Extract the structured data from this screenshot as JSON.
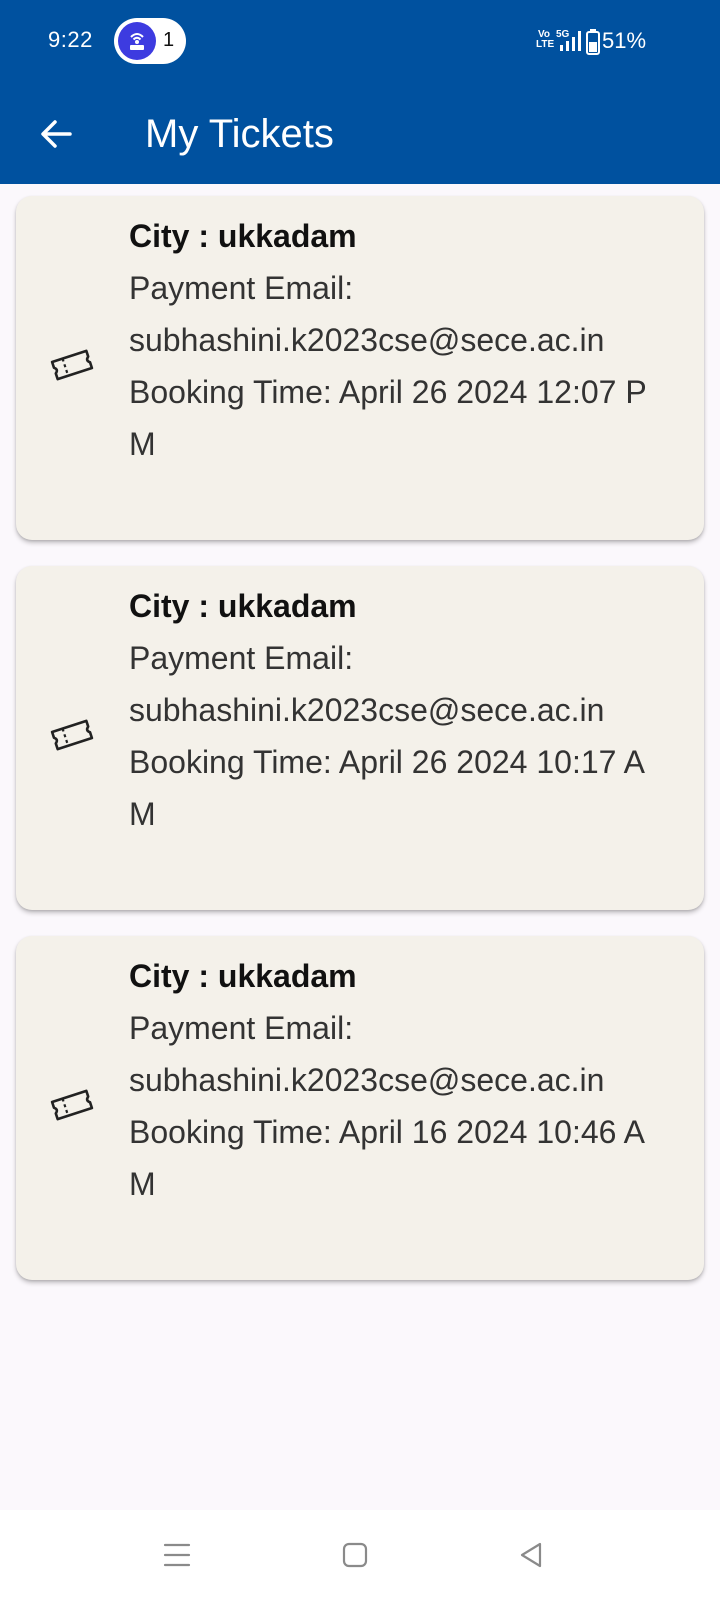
{
  "status_bar": {
    "time": "9:22",
    "hotspot_count": "1",
    "network": "5G",
    "battery": "51%",
    "icons": [
      "hotspot-icon",
      "volte-icon",
      "signal-icon",
      "battery-icon"
    ]
  },
  "app_bar": {
    "title": "My Tickets",
    "back_icon": "arrow-left-icon"
  },
  "tickets": [
    {
      "city": "City : ukkadam",
      "email_label": "Payment Email:",
      "email": "subhashini.k2023cse@sece.ac.in",
      "booking_label": "Booking Time:",
      "booking_time": "April 26 2024 12:07 PM",
      "icon": "ticket-icon"
    },
    {
      "city": "City : ukkadam",
      "email_label": "Payment Email:",
      "email": "subhashini.k2023cse@sece.ac.in",
      "booking_label": "Booking Time:",
      "booking_time": "April 26 2024 10:17 AM",
      "icon": "ticket-icon"
    },
    {
      "city": "City : ukkadam",
      "email_label": "Payment Email:",
      "email": "subhashini.k2023cse@sece.ac.in",
      "booking_label": "Booking Time:",
      "booking_time": "April 16 2024 10:46 AM",
      "icon": "ticket-icon"
    }
  ],
  "nav_bar": {
    "icons": [
      "menu-icon",
      "home-icon",
      "back-triangle-icon"
    ]
  },
  "colors": {
    "app_bar": "#00519f",
    "card_background": "#f4f1ea",
    "page_background": "#fbf8fc",
    "hotspot_accent": "#3d3be0"
  }
}
